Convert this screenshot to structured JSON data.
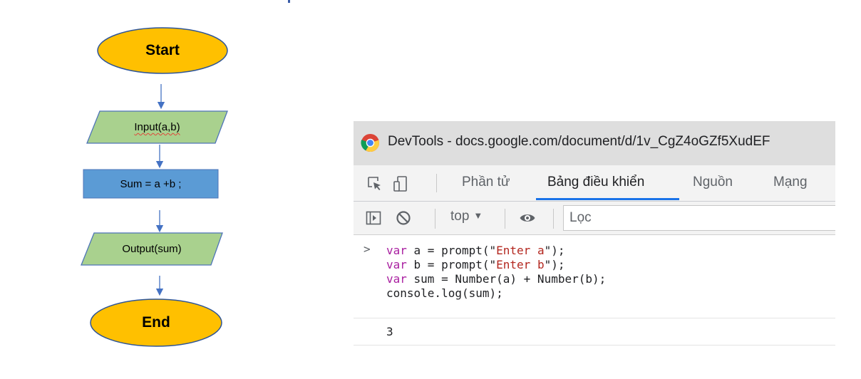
{
  "flowchart": {
    "start_label": "Start",
    "input_label": "Input(a,b)",
    "process_label": "Sum = a +b ;",
    "output_label": "Output(sum)",
    "end_label": "End",
    "colors": {
      "terminal_fill": "#ffc000",
      "terminal_stroke": "#2e5597",
      "io_fill": "#a9d18e",
      "io_stroke": "#4e74b8",
      "process_fill": "#5b9bd5",
      "arrow": "#4472c4"
    }
  },
  "devtools": {
    "window_title": "DevTools - docs.google.com/document/d/1v_CgZ4oGZf5XudEF",
    "tabs": [
      {
        "label": "Phần tử"
      },
      {
        "label": "Bảng điều khiển"
      },
      {
        "label": "Nguồn"
      },
      {
        "label": "Mạng"
      }
    ],
    "active_tab": "Bảng điều khiển",
    "toolbar": {
      "context": "top",
      "filter_placeholder": "Lọc"
    },
    "console": {
      "code_lines": [
        "var a = prompt(\"Enter a\");",
        "var b = prompt(\"Enter b\");",
        "var sum = Number(a) + Number(b);",
        "console.log(sum);"
      ],
      "output": "3"
    },
    "colors": {
      "accent": "#1a73e8",
      "keyword": "#a91fa0",
      "string": "#b3261e"
    }
  }
}
